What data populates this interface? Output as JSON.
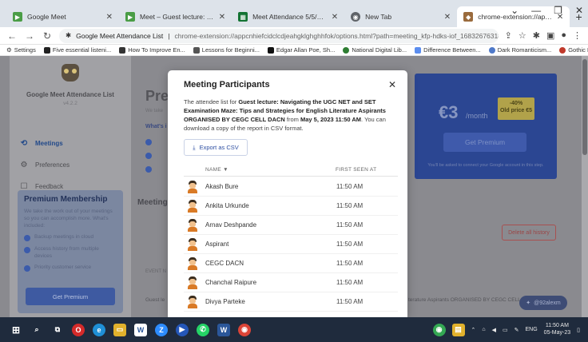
{
  "browser": {
    "tabs": [
      {
        "title": "Google Meet",
        "color": "#4a9d46"
      },
      {
        "title": "Meet – Guest lecture: Nav…",
        "color": "#4a9d46"
      },
      {
        "title": "Meet Attendance 5/5/2023",
        "color": "#137333"
      },
      {
        "title": "New Tab",
        "color": "#5f6368"
      },
      {
        "title": "chrome-extension://appcnh…",
        "color": "#9a6b3d"
      }
    ],
    "active_tab": 4,
    "site_name": "Google Meet Attendance List",
    "url": "chrome-extension://appcnhiefcidclcdjeahgklghghhfok/options.html?path=meeting_kfp-hdks-iof_1683267631826",
    "bookmarks": [
      "Settings",
      "Five essential listeni...",
      "How To Improve En...",
      "Lessons for Beginni...",
      "Edgar Allan Poe, Sh...",
      "National Digital Lib...",
      "Difference Between...",
      "Dark Romanticism...",
      "Gothic Literature Q..."
    ]
  },
  "sidebar": {
    "app_title": "Google Meet Attendance List",
    "version": "v4.2.2",
    "nav": [
      {
        "label": "Meetings",
        "icon": "⟲"
      },
      {
        "label": "Preferences",
        "icon": "⚙"
      },
      {
        "label": "Feedback",
        "icon": "☐"
      }
    ],
    "premium": {
      "title": "Premium Membership",
      "desc": "We take the work out of your meetings so you can accomplish more. What's included:",
      "features": [
        "Backup meetings in cloud",
        "Access history from multiple devices",
        "Priority customer service"
      ],
      "button": "Get Premium"
    }
  },
  "background": {
    "title": "Pren",
    "sub1": "We take",
    "sub2": "What's i",
    "meetings_heading": "Meeting",
    "event_label": "EVENT N",
    "guest_label": "Guest le",
    "right_text": "terature Aspirants ORGANISED BY CEGC CELL DA",
    "price": {
      "amount": "€3",
      "per": "/month",
      "discount_pct": "-40%",
      "old_price": "Old price €5",
      "button": "Get Premium",
      "note": "You'll be asked to connect your Google account in this step."
    },
    "delete_history": "Delete all history",
    "twitter_handle": "@92alexm"
  },
  "modal": {
    "title": "Meeting Participants",
    "desc_prefix": "The attendee list for ",
    "meeting_name": "Guest lecture: Navigating the UGC NET and SET Examination Maze: Tips and Strategies for English Literature Aspirants ORGANISED BY CEGC CELL DACN",
    "desc_from": " from ",
    "meeting_date": "May 5, 2023 11:50 AM",
    "desc_suffix": ". You can download a copy of the report in CSV format.",
    "export_label": "Export as CSV",
    "col_name": "NAME ▼",
    "col_first_seen": "FIRST SEEN AT",
    "rows": [
      {
        "name": "Akash Bure",
        "time": "11:50 AM"
      },
      {
        "name": "Ankita Urkunde",
        "time": "11:50 AM"
      },
      {
        "name": "Arnav Deshpande",
        "time": "11:50 AM"
      },
      {
        "name": "Aspirant",
        "time": "11:50 AM"
      },
      {
        "name": "CEGC DACN",
        "time": "11:50 AM"
      },
      {
        "name": "Chanchal Raipure",
        "time": "11:50 AM"
      },
      {
        "name": "Divya Parteke",
        "time": "11:50 AM"
      }
    ]
  },
  "taskbar": {
    "lang": "ENG",
    "time": "11:50 AM",
    "date": "05-May-23"
  }
}
